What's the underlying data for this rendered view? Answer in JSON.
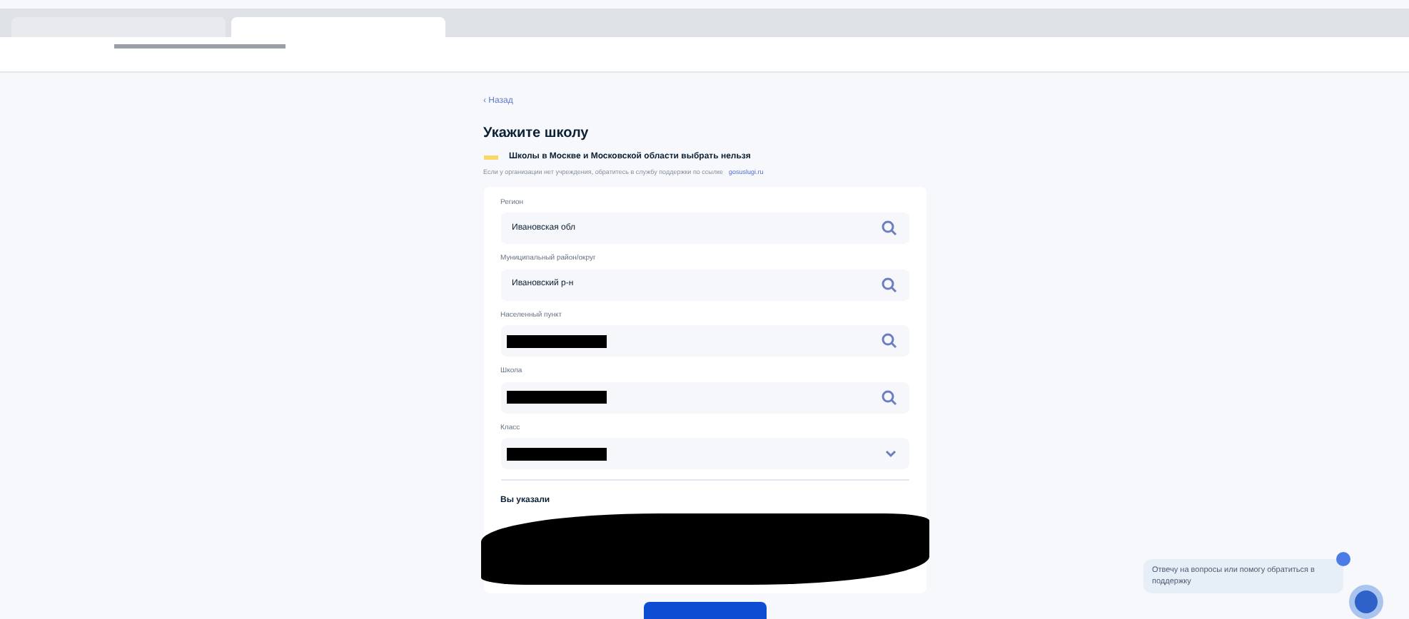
{
  "page": {
    "back_link": "‹ Назад",
    "title": "Укажите школу",
    "notice": "Школы в Москве и Московской области выбрать нельзя",
    "hint": "Если у организации нет учреждения, обратитесь в службу поддержки по ссылке",
    "hint_link": "gosuslugi.ru"
  },
  "fields": [
    {
      "label": "Регион",
      "value": "Ивановская обл",
      "kind": "search",
      "redacted": false
    },
    {
      "label": "Муниципальный район/округ",
      "value": "Ивановский р-н",
      "kind": "search",
      "redacted": false
    },
    {
      "label": "Населенный пункт",
      "kind": "search",
      "redacted": true
    },
    {
      "label": "Школа",
      "kind": "search",
      "redacted": true
    },
    {
      "label": "Класс",
      "kind": "select",
      "redacted": true
    }
  ],
  "summary": {
    "title": "Вы указали",
    "redacted": true
  },
  "chat": {
    "message": "Отвечу на вопросы или помогу обратиться в поддержку"
  }
}
